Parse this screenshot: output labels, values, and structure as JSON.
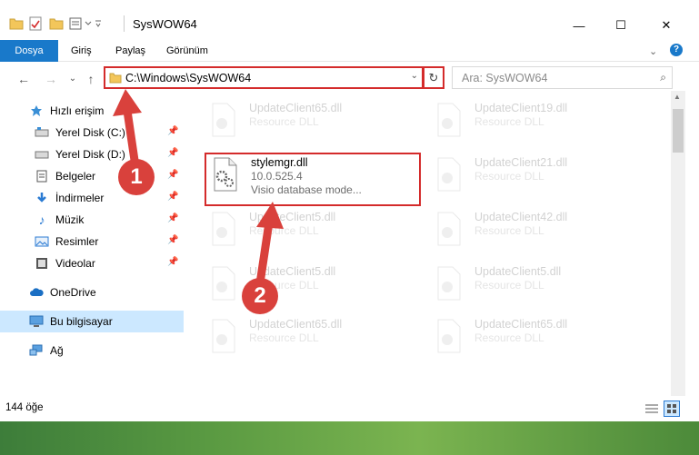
{
  "window": {
    "title": "SysWOW64",
    "minimize": "—",
    "maximize": "☐",
    "close": "✕"
  },
  "ribbon": {
    "tabs": [
      "Dosya",
      "Giriş",
      "Paylaş",
      "Görünüm"
    ],
    "help": "?"
  },
  "address": {
    "path": "C:\\Windows\\SysWOW64",
    "search_placeholder": "Ara: SysWOW64"
  },
  "sidebar": {
    "items": [
      {
        "label": "Hızlı erişim",
        "icon": "star-icon"
      },
      {
        "label": "Yerel Disk (C:)",
        "icon": "drive-icon",
        "pinned": true
      },
      {
        "label": "Yerel Disk (D:)",
        "icon": "drive-icon",
        "pinned": true
      },
      {
        "label": "Belgeler",
        "icon": "documents-icon",
        "pinned": true
      },
      {
        "label": "İndirmeler",
        "icon": "download-icon",
        "pinned": true
      },
      {
        "label": "Müzik",
        "icon": "music-icon",
        "pinned": true
      },
      {
        "label": "Resimler",
        "icon": "pictures-icon",
        "pinned": true
      },
      {
        "label": "Videolar",
        "icon": "video-icon",
        "pinned": true
      },
      {
        "label": "OneDrive",
        "icon": "cloud-icon"
      },
      {
        "label": "Bu bilgisayar",
        "icon": "computer-icon",
        "selected": true
      },
      {
        "label": "Ağ",
        "icon": "network-icon"
      }
    ]
  },
  "files": {
    "col1": [
      {
        "name": "UpdateClient65.dll",
        "sub": "Resource DLL",
        "faded": true
      },
      {
        "name": "stylemgr.dll",
        "version": "10.0.525.4",
        "sub": "Visio database mode...",
        "faded": false
      },
      {
        "name": "UpdateClient5.dll",
        "sub": "Resource DLL",
        "faded": true
      },
      {
        "name": "UpdateClient5.dll",
        "sub": "Resource DLL",
        "faded": true
      },
      {
        "name": "UpdateClient65.dll",
        "sub": "Resource DLL",
        "faded": true
      }
    ],
    "col2": [
      {
        "name": "UpdateClient19.dll",
        "sub": "Resource DLL",
        "faded": true
      },
      {
        "name": "UpdateClient21.dll",
        "sub": "Resource DLL",
        "faded": true
      },
      {
        "name": "UpdateClient42.dll",
        "sub": "Resource DLL",
        "faded": true
      },
      {
        "name": "UpdateClient5.dll",
        "sub": "Resource DLL",
        "faded": true
      },
      {
        "name": "UpdateClient65.dll",
        "sub": "Resource DLL",
        "faded": true
      }
    ]
  },
  "status": {
    "count": "144 öğe"
  },
  "annotations": {
    "badge1": "1",
    "badge2": "2"
  },
  "colors": {
    "accent": "#1979ca",
    "highlight": "#d42b2b",
    "selected": "#cce8ff",
    "badge": "#d9413c"
  }
}
